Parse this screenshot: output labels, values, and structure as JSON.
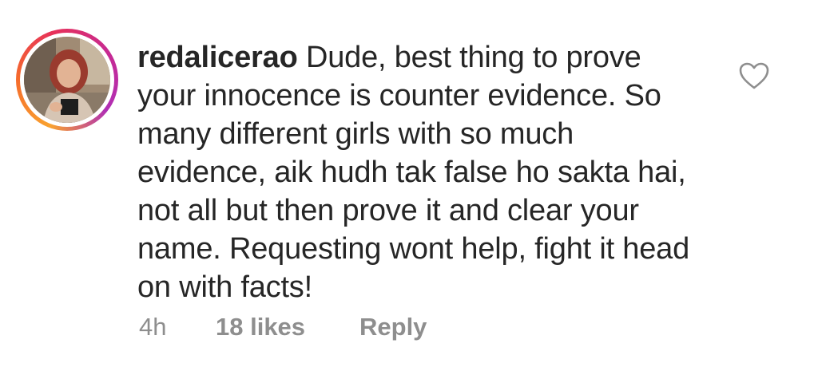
{
  "comment": {
    "username": "redalicerao",
    "text": "Dude, best thing to prove your innocence is counter evidence. So many different girls with so much evidence, aik hudh tak false ho sakta hai, not all but then prove it and clear your name. Requesting wont help, fight it head on with facts!",
    "time": "4h",
    "likes": "18 likes",
    "reply_label": "Reply"
  },
  "icons": {
    "like": "heart-outline-icon",
    "avatar_ring": "story-ring"
  },
  "colors": {
    "text": "#262626",
    "meta": "#8e8e8e",
    "ring_start": "#f9a22f",
    "ring_end": "#c72a92"
  }
}
